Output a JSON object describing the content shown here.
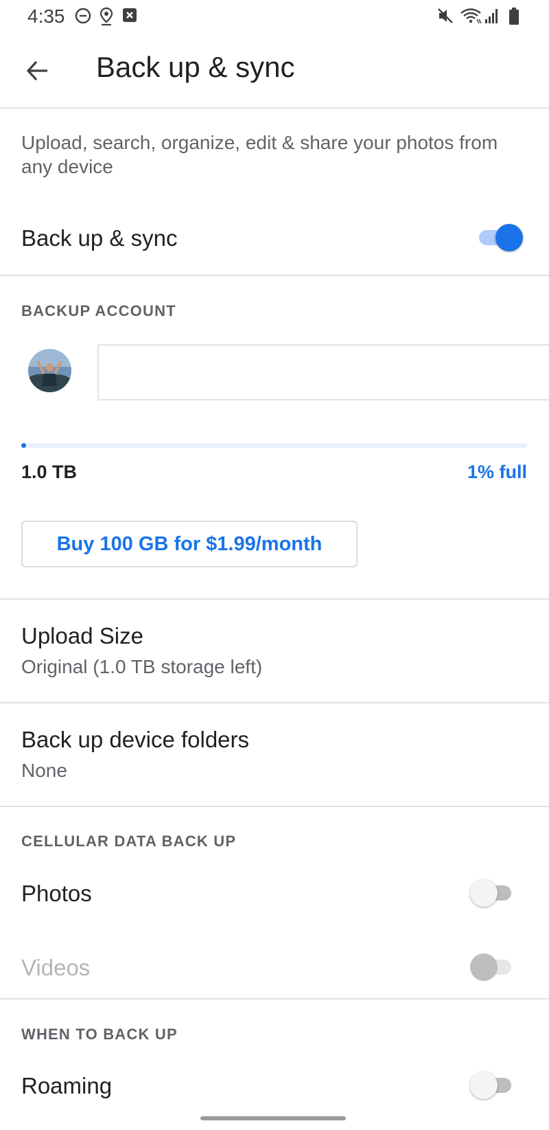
{
  "status_bar": {
    "time": "4:35",
    "icons_left": [
      "do-not-disturb-icon",
      "location-icon",
      "notification-x-icon"
    ],
    "icons_right": [
      "mute-icon",
      "wifi-icon",
      "cell-signal-icon",
      "battery-icon"
    ]
  },
  "app_bar": {
    "title": "Back up & sync",
    "back_icon": "arrow-back-icon"
  },
  "description": "Upload, search, organize, edit & share your photos from any device",
  "main_toggle": {
    "label": "Back up & sync",
    "on": true
  },
  "backup_account": {
    "header": "BACKUP ACCOUNT",
    "storage_total": "1.0 TB",
    "storage_used_label": "1% full",
    "storage_fraction": 0.01,
    "buy_button": "Buy 100 GB for $1.99/month"
  },
  "upload_size": {
    "title": "Upload Size",
    "value": "Original (1.0 TB storage left)"
  },
  "device_folders": {
    "title": "Back up device folders",
    "value": "None"
  },
  "cellular": {
    "header": "CELLULAR DATA BACK UP",
    "photos": {
      "label": "Photos",
      "on": false,
      "enabled": true
    },
    "videos": {
      "label": "Videos",
      "on": false,
      "enabled": false
    }
  },
  "when": {
    "header": "WHEN TO BACK UP",
    "roaming": {
      "label": "Roaming",
      "on": false
    }
  },
  "colors": {
    "accent": "#1a73e8",
    "accent_track": "#aecbfa",
    "divider": "#e3e3e3",
    "text_secondary": "#5f6368"
  }
}
